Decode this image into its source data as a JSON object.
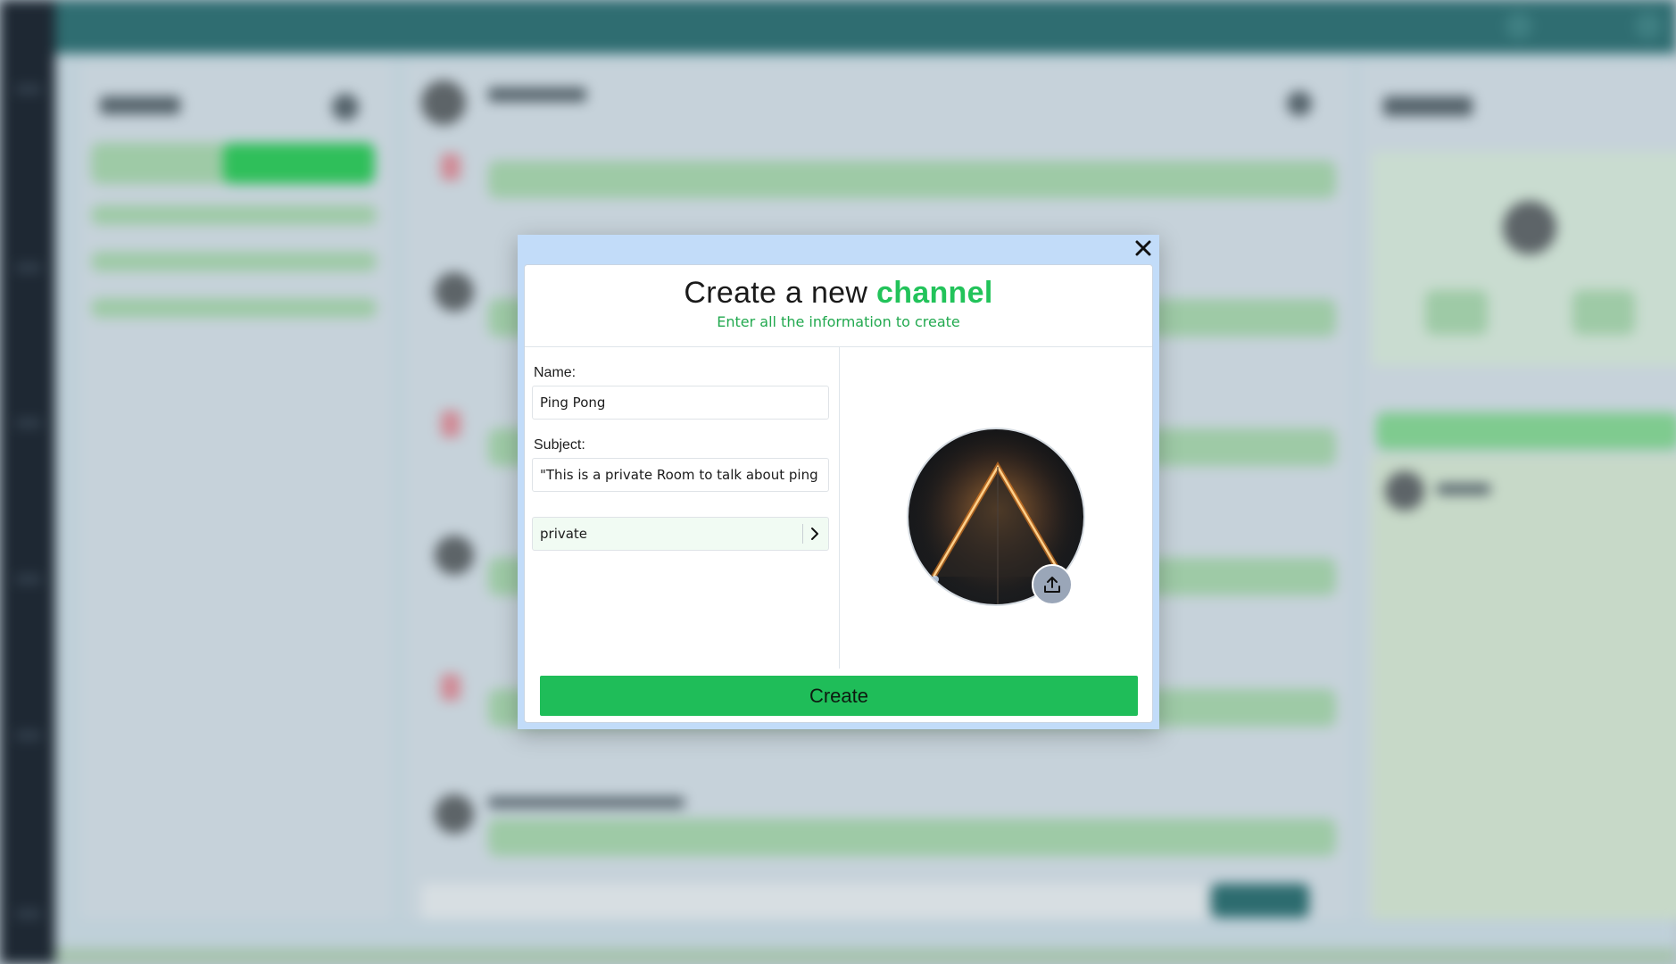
{
  "modal": {
    "title_prefix": "Create a new ",
    "title_accent": "channel",
    "subtitle": "Enter all the information to create",
    "close_icon": "close-icon",
    "accent_color": "#22c35a"
  },
  "form": {
    "name_label": "Name:",
    "name_value": "Ping Pong",
    "subject_label": "Subject:",
    "subject_value": "\"This is a private Room to talk about ping pong",
    "privacy_value": "private",
    "privacy_icon": "chevron-right-icon"
  },
  "image": {
    "upload_icon": "upload-icon"
  },
  "actions": {
    "create_label": "Create",
    "create_color": "#1fbd59"
  }
}
